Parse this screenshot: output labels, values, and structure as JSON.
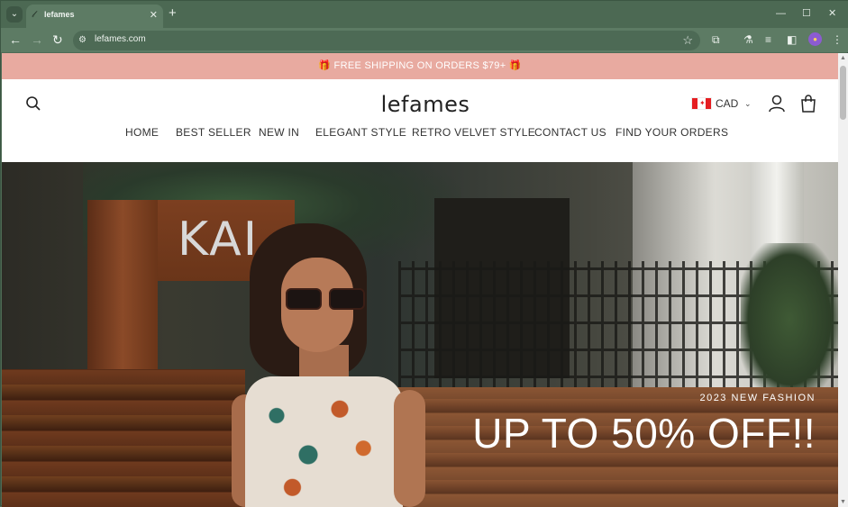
{
  "browser": {
    "tab_title": "lefames",
    "url": "lefames.com",
    "new_tab_symbol": "+",
    "tab_close_symbol": "✕"
  },
  "announcement": {
    "text": "🎁 FREE SHIPPING ON ORDERS $79+ 🎁",
    "background": "#e8aaa0"
  },
  "header": {
    "logo": "lefames",
    "currency": "CAD",
    "nav": [
      "HOME",
      "BEST SELLER",
      "NEW IN",
      "ELEGANT STYLE",
      "RETRO VELVET STYLE",
      "CONTACT US",
      "FIND YOUR ORDERS"
    ]
  },
  "hero": {
    "eyebrow": "2023 NEW FASHION",
    "title": "UP TO 50% OFF!!",
    "sign_text": "KAI"
  },
  "icons": {
    "search": "search-icon",
    "account": "account-icon",
    "bag": "shopping-bag-icon"
  }
}
